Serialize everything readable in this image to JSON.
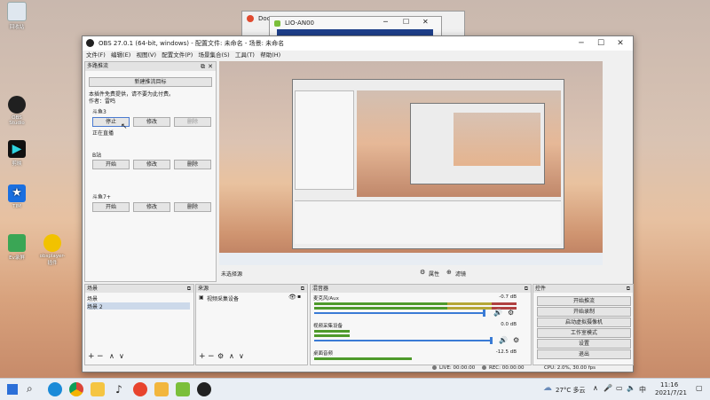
{
  "desktop": {
    "icons": [
      {
        "label": "回收站",
        "icon": "recycle-bin-icon",
        "color": "#dfe7ef"
      },
      {
        "label": "OBS Studio",
        "icon": "obs-icon",
        "color": "#202020"
      },
      {
        "label": "剪映",
        "icon": "video-editor-icon",
        "color": "#111111"
      },
      {
        "label": "TIM",
        "icon": "tim-icon",
        "color": "#1a6fe0"
      },
      {
        "label": "Ev录屏",
        "icon": "recorder-icon",
        "color": "#3aa655"
      },
      {
        "label": "obsplayer-插件",
        "icon": "plugin-icon",
        "color": "#f2c200"
      }
    ]
  },
  "background_windows": {
    "doc_title": "Doc",
    "lio_title": "LIO-AN00"
  },
  "obs": {
    "title": "OBS 27.0.1 (64-bit, windows) - 配置文件: 未命名 - 场景: 未命名",
    "menu": [
      "文件(F)",
      "编辑(E)",
      "视图(V)",
      "配置文件(P)",
      "场景集合(S)",
      "工具(T)",
      "帮助(H)"
    ],
    "plugin": {
      "header": "多路推流",
      "new_target": "新建推流目标",
      "notice_line1": "本插件免费提供，请不要为此付费。",
      "notice_line2": "作者：雷鸣",
      "targets": [
        {
          "name": "斗鱼3",
          "start": "停止",
          "edit": "修改",
          "delete": "删除",
          "status": "正在直播"
        },
        {
          "name": "B站",
          "start": "开始",
          "edit": "修改",
          "delete": "删除",
          "status": ""
        },
        {
          "name": "斗鱼7+",
          "start": "开始",
          "edit": "修改",
          "delete": "删除",
          "status": ""
        }
      ]
    },
    "preview_bar": {
      "source_label": "未选择源",
      "properties": "属性",
      "filters": "滤镜"
    },
    "scenes": {
      "header": "场景",
      "items": [
        "场景",
        "场景 2"
      ]
    },
    "sources": {
      "header": "来源",
      "items": [
        "视频采集设备"
      ]
    },
    "mixer": {
      "header": "混音器",
      "tracks": [
        {
          "name": "麦克风/Aux",
          "level": "-0.7 dB"
        },
        {
          "name": "视频采集设备",
          "level": "0.0 dB"
        },
        {
          "name": "桌面音频",
          "level": "-12.5 dB"
        }
      ]
    },
    "controls": {
      "header": "控件",
      "buttons": [
        "开始推流",
        "开始录制",
        "启动虚拟摄像机",
        "工作室模式",
        "设置",
        "退出"
      ]
    },
    "status": {
      "live": "LIVE: 00:00:00",
      "rec": "REC: 00:00:00",
      "cpu": "CPU: 2.0%, 30.00 fps"
    }
  },
  "taskbar": {
    "weather": "27°C 多云",
    "ime": "中",
    "time": "11:16",
    "date": "2021/7/21"
  }
}
